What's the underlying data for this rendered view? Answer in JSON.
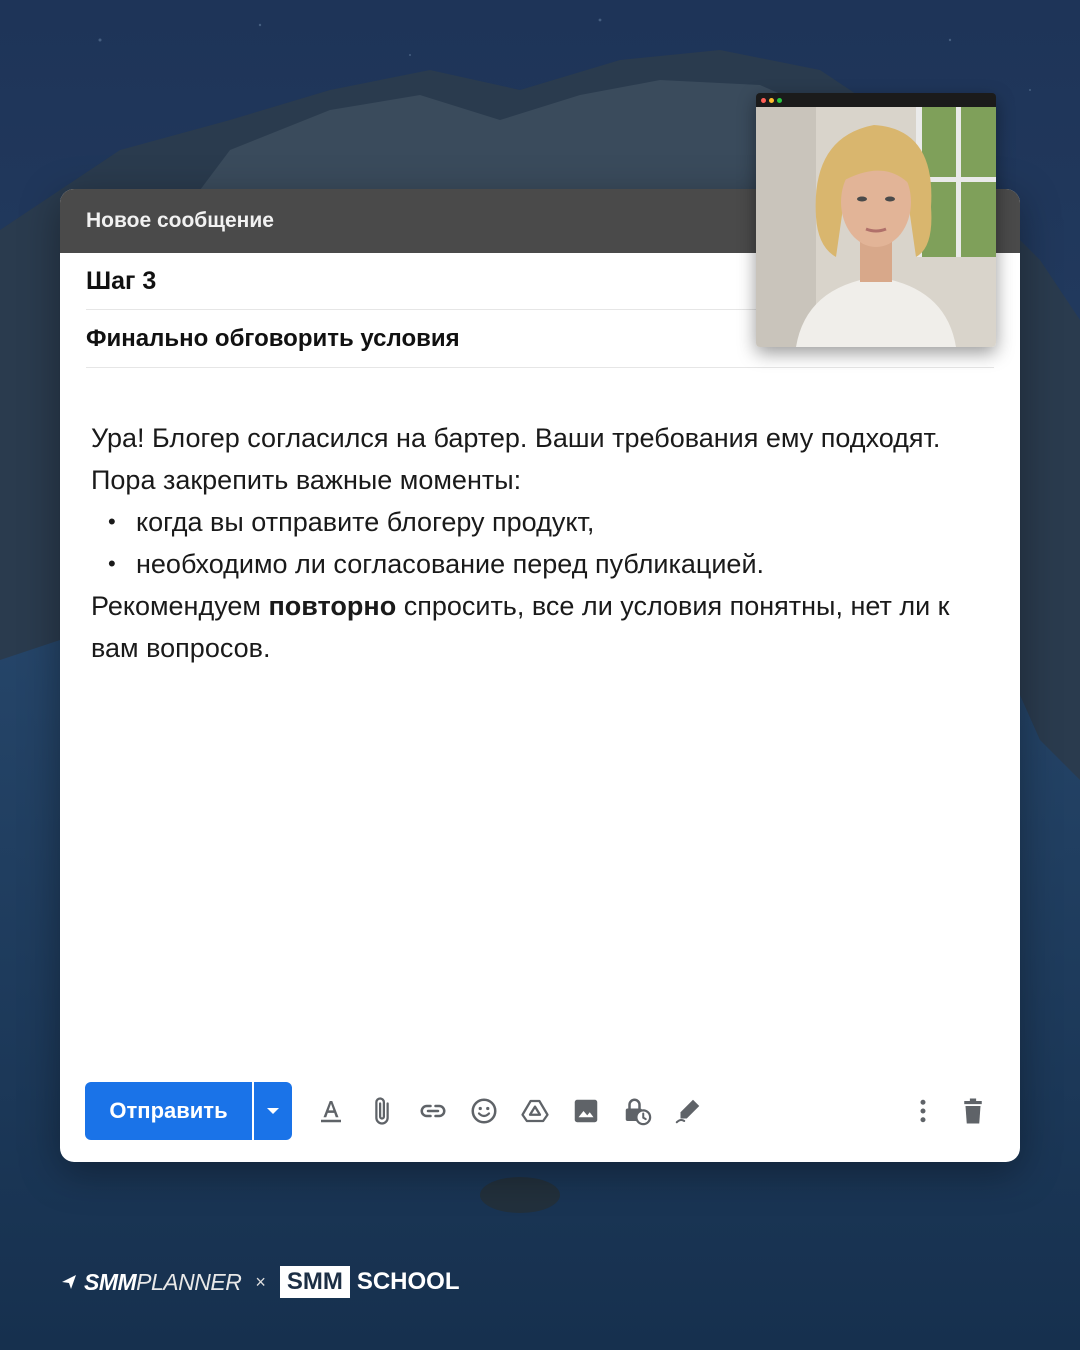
{
  "colors": {
    "header_bg": "#4a4a4a",
    "send_button": "#1a73e8",
    "icon_gray": "#5f6368",
    "background_sky": "#1f3a5c"
  },
  "compose": {
    "window_title": "Новое сообщение",
    "to": "Шаг 3",
    "subject": "Финально обговорить условия",
    "body": {
      "paragraph1": "Ура! Блогер согласился на бартер. Ваши требования ему подходят. Пора закрепить важные моменты:",
      "bullets": [
        "когда вы отправите блогеру продукт,",
        "необходимо ли согласование перед публикацией."
      ],
      "paragraph2_before": "Рекомендуем ",
      "paragraph2_bold": "повторно",
      "paragraph2_after": " спросить, все ли условия понятны, нет ли к вам вопросов."
    }
  },
  "toolbar": {
    "send_label": "Отправить",
    "icons": [
      "send-options-icon",
      "text-format-icon",
      "attach-icon",
      "link-icon",
      "emoji-icon",
      "drive-icon",
      "image-icon",
      "confidential-mode-icon",
      "signature-icon",
      "more-options-icon",
      "trash-icon"
    ]
  },
  "footer": {
    "brand1_bold": "SMM",
    "brand1_light": "PLANNER",
    "separator": "×",
    "brand2_box": "SMM",
    "brand2_text": "SCHOOL"
  }
}
